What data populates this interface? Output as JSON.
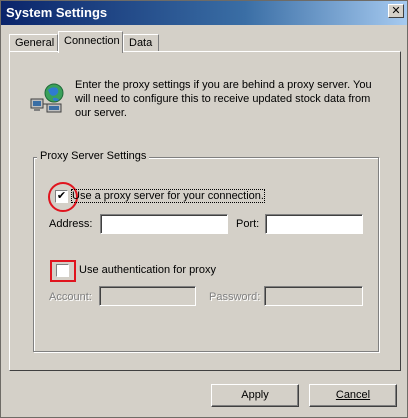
{
  "window": {
    "title": "System Settings",
    "close_glyph": "✕"
  },
  "tabs": [
    {
      "label": "General",
      "active": false
    },
    {
      "label": "Connection",
      "active": true
    },
    {
      "label": "Data",
      "active": false
    }
  ],
  "info": {
    "icon": "network-globe-icon",
    "text": "Enter the proxy settings if you are behind a proxy server. You will need to configure this to receive updated stock data from our server."
  },
  "proxy_group": {
    "legend": "Proxy Server Settings",
    "use_proxy": {
      "label": "Use a proxy server for your connection.",
      "checked": true,
      "check_glyph": "✔"
    },
    "address": {
      "label": "Address:",
      "value": ""
    },
    "port": {
      "label": "Port:",
      "value": ""
    },
    "use_auth": {
      "label": "Use authentication for proxy",
      "checked": false
    },
    "account": {
      "label": "Account:",
      "value": ""
    },
    "password": {
      "label": "Password:",
      "value": ""
    }
  },
  "buttons": {
    "apply": "Apply",
    "cancel": "Cancel"
  },
  "colors": {
    "title_gradient_start": "#0a246a",
    "title_gradient_end": "#a6caf0",
    "highlight_red": "#e0141e",
    "face": "#d4d0c8"
  }
}
